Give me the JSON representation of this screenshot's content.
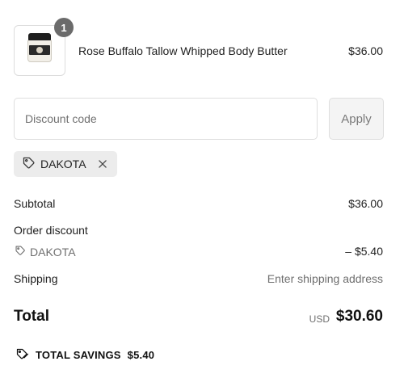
{
  "line_item": {
    "quantity": "1",
    "name": "Rose Buffalo Tallow Whipped Body Butter",
    "price": "$36.00"
  },
  "discount": {
    "placeholder": "Discount code",
    "value": "",
    "apply_label": "Apply",
    "applied_code": "DAKOTA"
  },
  "summary": {
    "subtotal_label": "Subtotal",
    "subtotal_value": "$36.00",
    "order_discount_label": "Order discount",
    "discount_code": "DAKOTA",
    "discount_value": "– $5.40",
    "shipping_label": "Shipping",
    "shipping_value": "Enter shipping address",
    "total_label": "Total",
    "currency": "USD",
    "total_value": "$30.60",
    "savings_label": "TOTAL SAVINGS",
    "savings_value": "$5.40"
  },
  "icons": {
    "tag": "tag-icon",
    "close": "close-icon",
    "savings": "tag-icon"
  },
  "colors": {
    "badge": "#6b6b6b",
    "chip_bg": "#ececec",
    "apply_bg": "#f4f4f4"
  }
}
